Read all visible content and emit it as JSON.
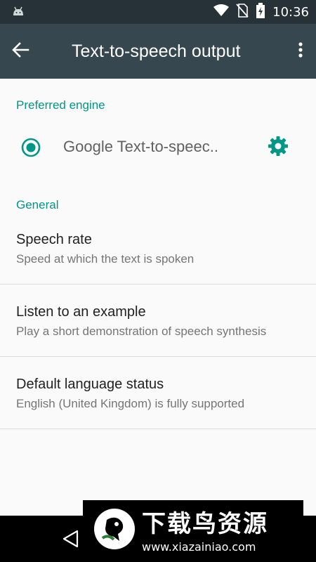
{
  "status_bar": {
    "time": "10:36"
  },
  "app_bar": {
    "title": "Text-to-speech output"
  },
  "preferred_engine": {
    "header": "Preferred engine",
    "engine_label": "Google Text-to-speec.."
  },
  "general": {
    "header": "General",
    "items": [
      {
        "title": "Speech rate",
        "summary": "Speed at which the text is spoken"
      },
      {
        "title": "Listen to an example",
        "summary": "Play a short demonstration of speech synthesis"
      },
      {
        "title": "Default language status",
        "summary": "English (United Kingdom) is fully supported"
      }
    ]
  },
  "watermark": {
    "title": "下载鸟资源",
    "url": "www.xiazainiao.com"
  },
  "colors": {
    "accent": "#009688",
    "app_bar": "#37474f",
    "status_bar": "#263238"
  }
}
